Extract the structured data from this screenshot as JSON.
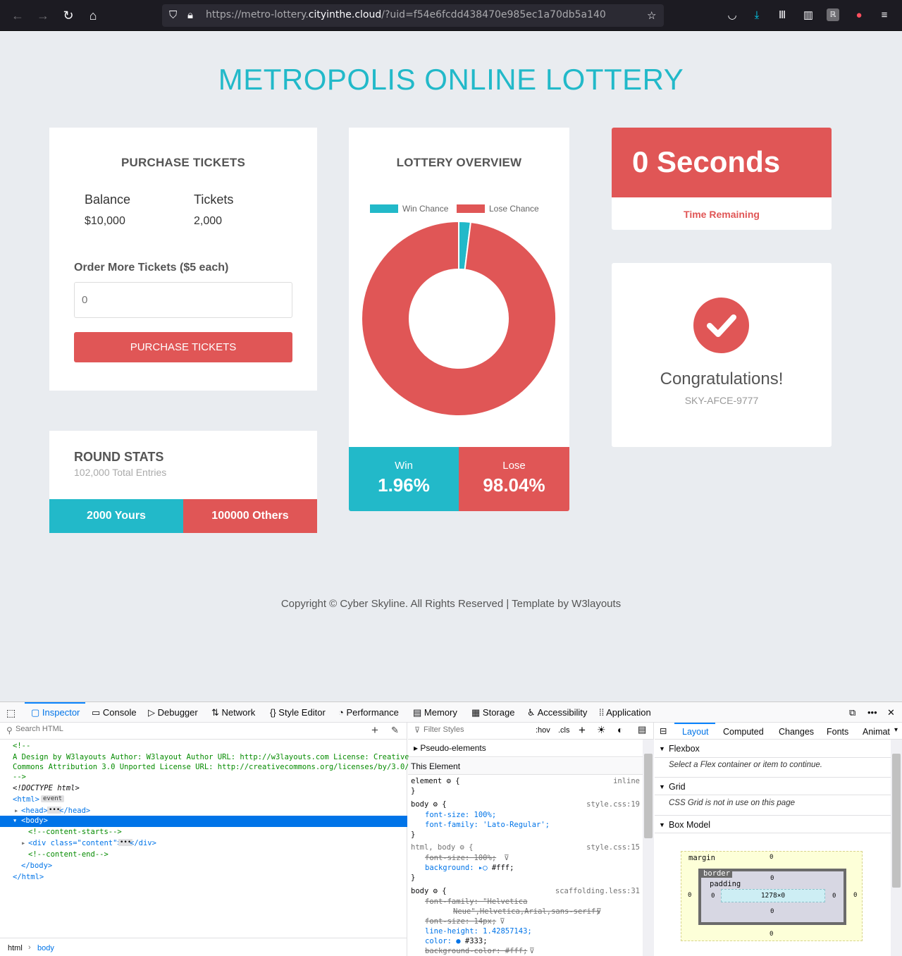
{
  "browser": {
    "url_prefix": "https://metro-lottery.",
    "url_domain": "cityinthe.cloud",
    "url_suffix": "/?uid=f54e6fcdd438470e985ec1a70db5a140"
  },
  "page": {
    "title": "METROPOLIS ONLINE LOTTERY",
    "purchase": {
      "heading": "PURCHASE TICKETS",
      "balance_label": "Balance",
      "balance_value": "$10,000",
      "tickets_label": "Tickets",
      "tickets_value": "2,000",
      "order_label": "Order More Tickets ($5 each)",
      "order_placeholder": "0",
      "button_label": "PURCHASE TICKETS"
    },
    "round_stats": {
      "heading": "ROUND STATS",
      "total_entries": "102,000 Total Entries",
      "yours": "2000 Yours",
      "others": "100000 Others"
    },
    "overview": {
      "heading": "LOTTERY OVERVIEW",
      "win_label": "Win",
      "win_value": "1.96%",
      "lose_label": "Lose",
      "lose_value": "98.04%"
    },
    "timer": {
      "value": "0 Seconds",
      "label": "Time Remaining"
    },
    "congrats": {
      "title": "Congratulations!",
      "code": "SKY-AFCE-9777"
    },
    "footer": "Copyright © Cyber Skyline. All Rights Reserved | Template by W3layouts"
  },
  "chart_data": {
    "type": "pie",
    "categories": [
      "Win Chance",
      "Lose Chance"
    ],
    "values": [
      1.96,
      98.04
    ],
    "colors": [
      "#22b9c9",
      "#e05656"
    ],
    "legend": "top",
    "donut": true
  },
  "devtools": {
    "tabs": [
      "Inspector",
      "Console",
      "Debugger",
      "Network",
      "Style Editor",
      "Performance",
      "Memory",
      "Storage",
      "Accessibility",
      "Application"
    ],
    "search_placeholder": "Search HTML",
    "filter_placeholder": "Filter Styles",
    "hov": ":hov",
    "cls": ".cls",
    "right_tabs": [
      "Layout",
      "Computed",
      "Changes",
      "Fonts",
      "Animat"
    ],
    "html_tree": [
      "<!--",
      "A Design by W3layouts Author: W3layout Author URL: http://w3layouts.com License: Creative",
      "Commons Attribution 3.0 Unported License URL: http://creativecommons.org/licenses/by/3.0/",
      "-->",
      "<!DOCTYPE html>",
      "<html>",
      "event",
      "<head>",
      "</head>",
      "<body>",
      "<!--content-starts-->",
      "<div class=\"content\">",
      "</div>",
      "<!--content-end-->",
      "</body>",
      "</html>"
    ],
    "breadcrumb": [
      "html",
      "body"
    ],
    "styles": {
      "pseudo": "Pseudo-elements",
      "this_element": "This Element",
      "element_rule": "element",
      "element_inline": "inline",
      "body_src1": "style.css:19",
      "body_font_size": "font-size: 100%;",
      "body_font_family": "font-family: 'Lato-Regular';",
      "htmlbody_selector": "html, body",
      "htmlbody_src": "style.css:15",
      "htmlbody_font_size": "font-size: 100%;",
      "htmlbody_bg": "background:",
      "htmlbody_bg_val": "#fff;",
      "body_src2": "scaffolding.less:31",
      "sc_font_family": "font-family: \"Helvetica",
      "sc_font_family2": "Neue\",Helvetica,Arial,sans-serif;",
      "sc_font_size": "font-size: 14px;",
      "sc_line_height": "line-height: 1.42857143;",
      "sc_color": "color:",
      "sc_color_val": "#333;",
      "sc_bg": "background-color: #fff;"
    },
    "layout": {
      "flexbox": "Flexbox",
      "flexbox_msg": "Select a Flex container or item to continue.",
      "grid": "Grid",
      "grid_msg": "CSS Grid is not in use on this page",
      "box_model": "Box Model",
      "margin": "margin",
      "border": "border",
      "padding": "padding",
      "size": "1278×0",
      "zero": "0"
    }
  }
}
